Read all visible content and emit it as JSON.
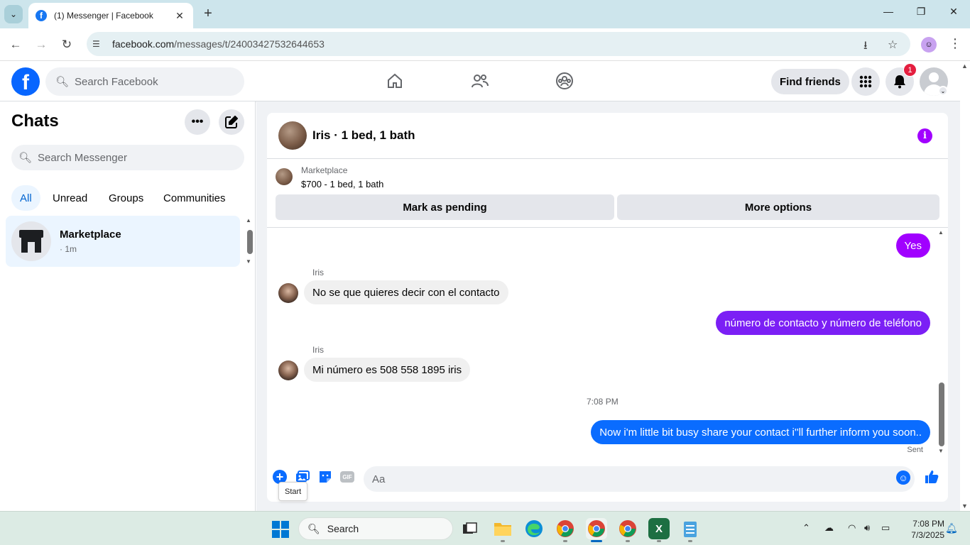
{
  "browser": {
    "tab_title": "(1) Messenger | Facebook",
    "url_host": "facebook.com",
    "url_path": "/messages/t/24003427532644653"
  },
  "fb_header": {
    "search_placeholder": "Search Facebook",
    "find_friends_label": "Find friends",
    "notification_count": "1"
  },
  "sidebar": {
    "title": "Chats",
    "search_placeholder": "Search Messenger",
    "filters": [
      "All",
      "Unread",
      "Groups",
      "Communities"
    ],
    "active_filter": "All",
    "chats": [
      {
        "name": "Marketplace",
        "time": "· 1m"
      }
    ]
  },
  "conversation": {
    "title": "Iris · 1 bed, 1 bath",
    "marketplace_label": "Marketplace",
    "listing": "$700 - 1 bed, 1 bath",
    "mark_pending_label": "Mark as pending",
    "more_options_label": "More options",
    "messages": [
      {
        "from": "me",
        "text": "Yes"
      },
      {
        "from": "Iris",
        "sender_label": "Iris",
        "text": "No se que quieres  decir  con el contacto"
      },
      {
        "from": "me",
        "text": "número de contacto y número de teléfono"
      },
      {
        "from": "Iris",
        "sender_label": "Iris",
        "text": "Mi número  es 508 558 1895  iris"
      },
      {
        "from": "me",
        "text": "Now i'm little bit busy share your contact i''ll further inform you soon.."
      }
    ],
    "timestamp": "7:08 PM",
    "sent_status": "Sent",
    "composer_placeholder": "Aa",
    "gif_label": "GIF",
    "tooltip": "Start"
  },
  "taskbar": {
    "search_label": "Search",
    "clock_time": "7:08 PM",
    "clock_date": "7/3/2025"
  },
  "colors": {
    "fb_blue": "#0866ff",
    "bubble_purple": "#a100ff",
    "bubble_violet": "#7b1ff5",
    "bubble_blue": "#0a6cff"
  }
}
